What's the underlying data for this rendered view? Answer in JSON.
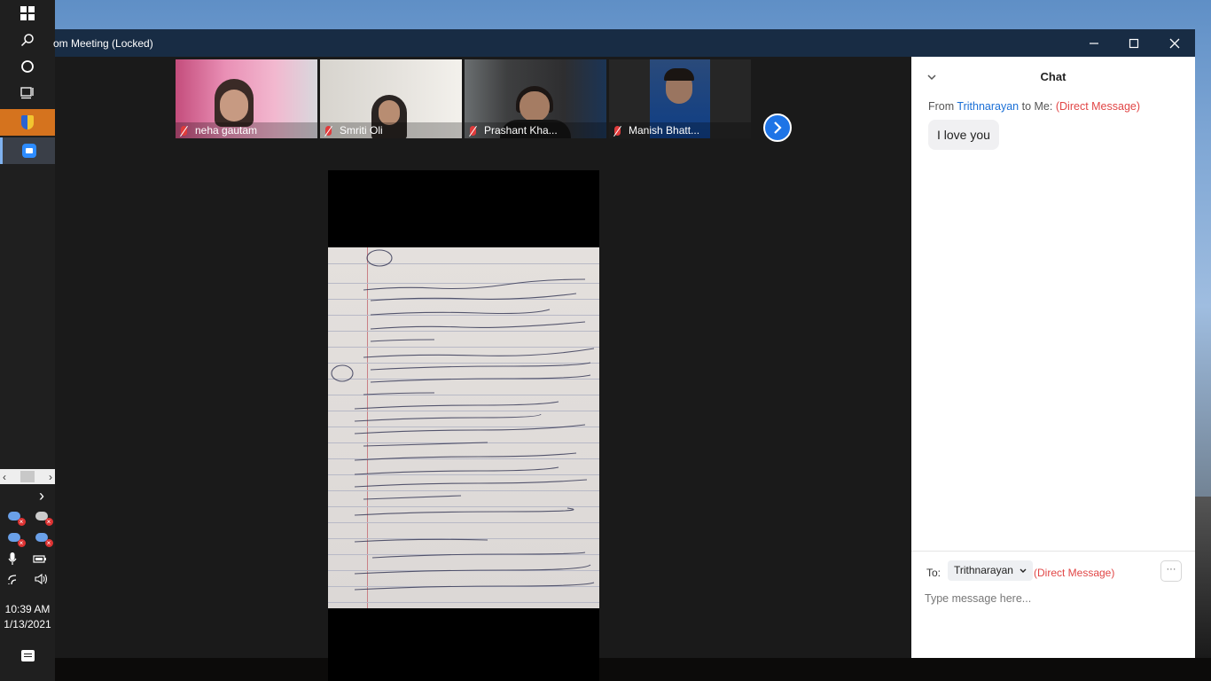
{
  "window": {
    "title": "om Meeting (Locked)",
    "controls": {
      "minimize": "—",
      "maximize": "☐",
      "close": "✕"
    }
  },
  "participants": [
    {
      "name": "neha gautam",
      "muted": true
    },
    {
      "name": "Smriti Oli",
      "muted": true
    },
    {
      "name": "Prashant Kha...",
      "muted": true
    },
    {
      "name": "Manish Bhatt...",
      "muted": true
    }
  ],
  "chat": {
    "title": "Chat",
    "from_prefix": "From",
    "from_name": "Trithnarayan",
    "to_me": "to Me:",
    "direct_message": "(Direct Message)",
    "messages": [
      {
        "text": "I love you"
      }
    ],
    "to_label": "To:",
    "to_recipient": "Trithnarayan",
    "to_dm": "(Direct Message)",
    "more": "···",
    "input_placeholder": "Type message here..."
  },
  "taskbar": {
    "time": "10:39 AM",
    "date": "1/13/2021",
    "chevron": "›"
  },
  "colors": {
    "titlebar": "#182c44",
    "accent": "#1e74e6",
    "dm_red": "#e14646",
    "link_blue": "#1a6fd6"
  }
}
